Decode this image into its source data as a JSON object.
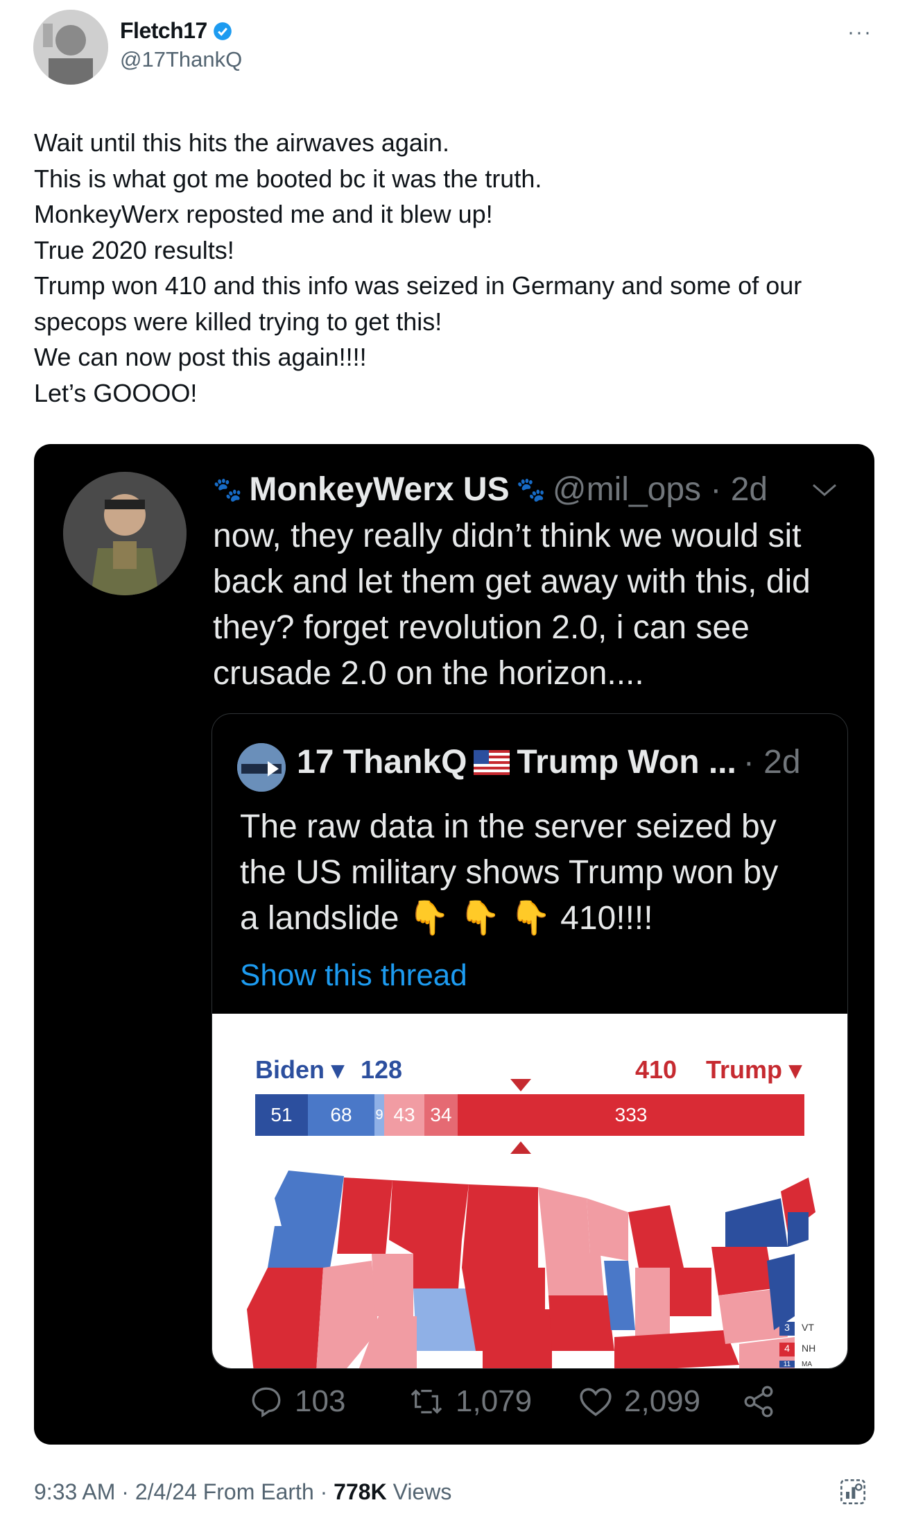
{
  "author": {
    "name": "Fletch17",
    "handle": "@17ThankQ",
    "verified_color": "#1d9bf0"
  },
  "more_label": "···",
  "tweet_lines": [
    "Wait until this hits the airwaves again.",
    "This is what got me booted bc it was the truth.",
    "MonkeyWerx reposted me and it blew up!",
    "True 2020 results!",
    "Trump won 410 and this info was seized in Germany and some of our",
    "specops were killed trying to get this!",
    "We can now post this again!!!!",
    "Let’s GOOOO!"
  ],
  "embedded": {
    "name": "MonkeyWerx US",
    "handle": "@mil_ops · 2d",
    "text_lines": [
      "now, they really didn’t think we would sit",
      "back and let them get away with this, did",
      "they? forget revolution 2.0, i can see",
      "crusade 2.0 on the horizon...."
    ],
    "quote": {
      "name": "17 ThankQ",
      "name2": "Trump Won ...",
      "time": "· 2d",
      "text_lines": [
        "The raw data in the server seized by",
        "the US military shows Trump won by",
        "a landslide 👇 👇 👇 410!!!!"
      ],
      "link": "Show this thread",
      "map": {
        "biden_label": "Biden ▾",
        "biden_count": "128",
        "trump_count": "410",
        "trump_label": "Trump ▾",
        "bar_segments": [
          "51",
          "68",
          "9",
          "43",
          "34",
          "333"
        ],
        "legend": [
          "VT",
          "NH",
          "MA"
        ],
        "legend_values": [
          "3",
          "4",
          "11"
        ]
      }
    },
    "actions": {
      "replies": "103",
      "reposts": "1,079",
      "likes": "2,099"
    }
  },
  "meta": {
    "time_date": "9:33 AM · 2/4/24 From Earth · ",
    "views_count": "778K",
    "views_label": " Views"
  }
}
